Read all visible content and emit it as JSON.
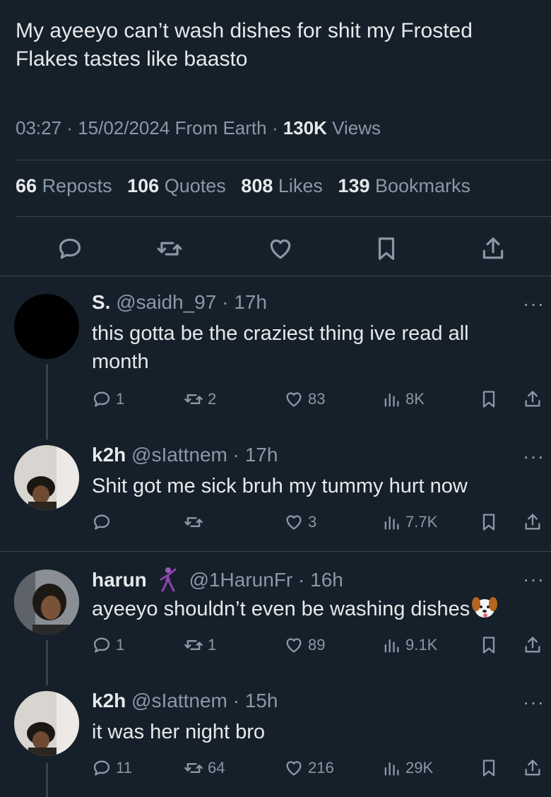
{
  "tweet": {
    "text": "My ayeeyo can’t wash dishes for shit my Frosted Flakes tastes like baasto",
    "time": "03:27",
    "date": "15/02/2024",
    "location": "From Earth",
    "views_count": "130K",
    "views_label": "Views",
    "stats": [
      {
        "count": "66",
        "label": "Reposts"
      },
      {
        "count": "106",
        "label": "Quotes"
      },
      {
        "count": "808",
        "label": "Likes"
      },
      {
        "count": "139",
        "label": "Bookmarks"
      }
    ],
    "actions": [
      "reply-icon",
      "repost-icon",
      "like-icon",
      "bookmark-icon",
      "share-icon"
    ]
  },
  "replies": [
    {
      "display_name": "S.",
      "handle": "@saidh_97",
      "time": "17h",
      "text": "this gotta be the craziest thing ive read all month",
      "replies": "1",
      "reposts": "2",
      "likes": "83",
      "views": "8K"
    },
    {
      "display_name": "k2h",
      "handle": "@sIattnem",
      "time": "17h",
      "text": "Shit got me sick bruh my tummy hurt now",
      "replies": "",
      "reposts": "",
      "likes": "3",
      "views": "7.7K"
    },
    {
      "display_name": "harun",
      "handle": "@1HarunFr",
      "time": "16h",
      "text": "ayeeyo shouldn’t even be washing dishes",
      "replies": "1",
      "reposts": "1",
      "likes": "89",
      "views": "9.1K"
    },
    {
      "display_name": "k2h",
      "handle": "@sIattnem",
      "time": "15h",
      "text": "it was her night bro",
      "replies": "11",
      "reposts": "64",
      "likes": "216",
      "views": "29K"
    }
  ],
  "colors": {
    "background": "#15202b",
    "text": "#e7e9ea",
    "muted": "#8b98a5",
    "divider": "#38444d"
  }
}
